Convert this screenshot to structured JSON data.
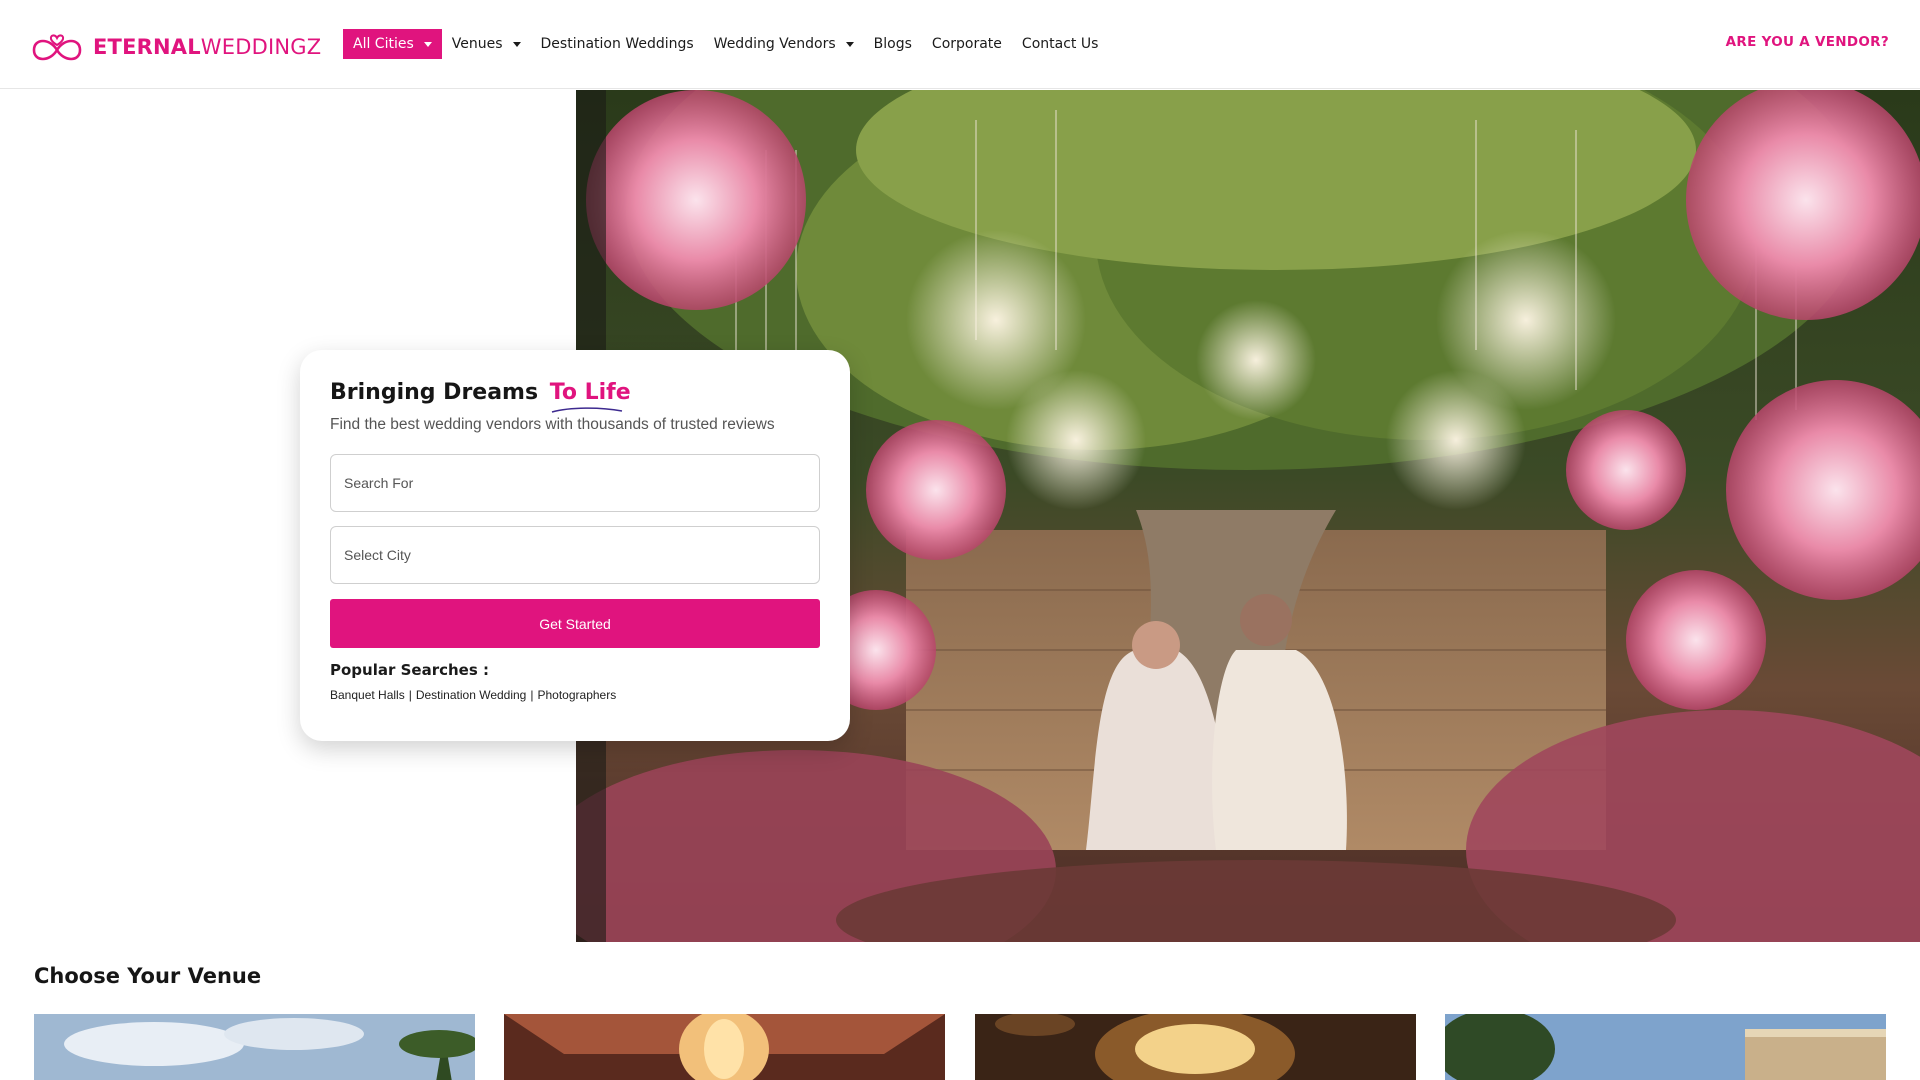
{
  "header": {
    "logo": {
      "part1": "ETERNAL",
      "part2": "WEDDINGZ"
    },
    "nav": [
      {
        "label": "All Cities",
        "active": true,
        "dropdown": true
      },
      {
        "label": "Venues",
        "active": false,
        "dropdown": true
      },
      {
        "label": "Destination Weddings",
        "active": false,
        "dropdown": false
      },
      {
        "label": "Wedding Vendors",
        "active": false,
        "dropdown": true
      },
      {
        "label": "Blogs",
        "active": false,
        "dropdown": false
      },
      {
        "label": "Corporate",
        "active": false,
        "dropdown": false
      },
      {
        "label": "Contact Us",
        "active": false,
        "dropdown": false
      }
    ],
    "vendor_link": "ARE YOU A VENDOR?"
  },
  "hero": {
    "title_main": "Bringing Dreams",
    "title_accent": "To Life",
    "subtitle": "Find the best wedding vendors with thousands of trusted reviews",
    "search_placeholder": "Search For",
    "city_placeholder": "Select City",
    "cta": "Get Started",
    "popular_title": "Popular Searches :",
    "popular": [
      "Banquet Halls",
      "Destination Wedding",
      "Photographers"
    ],
    "separator": "|"
  },
  "venues": {
    "title": "Choose Your Venue"
  },
  "colors": {
    "brand": "#e0147e",
    "text": "#1b1b1b"
  }
}
